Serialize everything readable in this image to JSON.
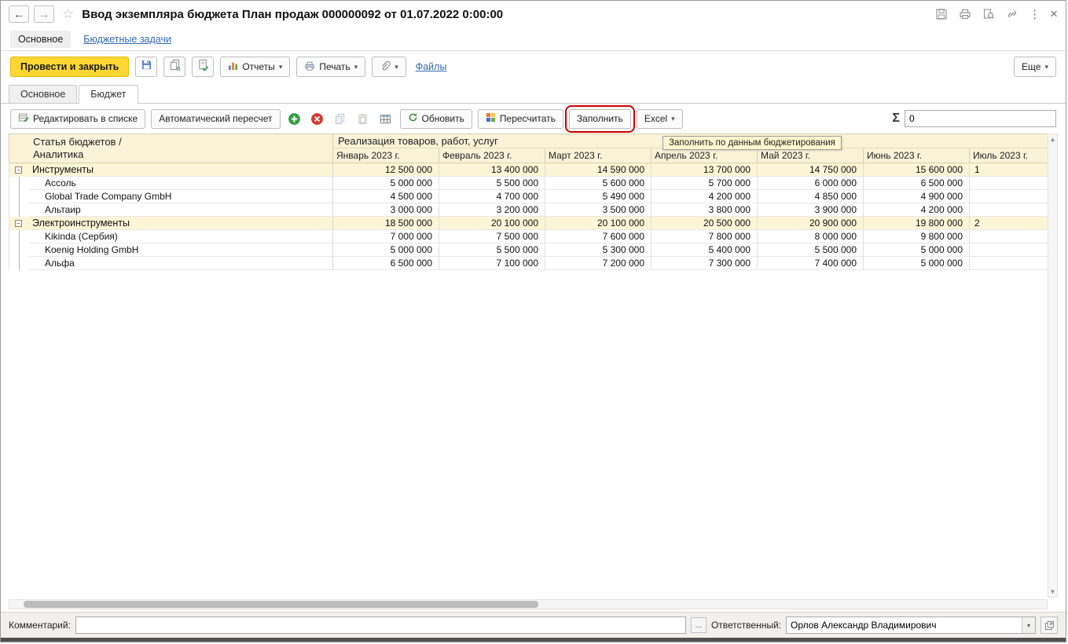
{
  "titlebar": {
    "title": "Ввод экземпляра бюджета План продаж 000000092 от 01.07.2022 0:00:00"
  },
  "icons": {
    "back": "←",
    "forward": "→",
    "star": "☆",
    "kebab": "⋮",
    "close": "×",
    "caret": "▾",
    "sigma": "Σ",
    "minus": "−",
    "up_arrow": "▲",
    "down_arrow": "▼",
    "ellipsis": "..."
  },
  "nav": {
    "section": "Основное",
    "link": "Бюджетные задачи"
  },
  "cmdbar": {
    "post_and_close": "Провести и закрыть",
    "reports": "Отчеты",
    "print": "Печать",
    "files": "Файлы",
    "more": "Еще"
  },
  "pagetabs": [
    {
      "label": "Основное"
    },
    {
      "label": "Бюджет"
    }
  ],
  "table_toolbar": {
    "edit_in_list": "Редактировать в списке",
    "auto_recalc": "Автоматический пересчет",
    "refresh": "Обновить",
    "recalc": "Пересчитать",
    "fill": "Заполнить",
    "excel": "Excel",
    "sum_value": "0"
  },
  "tooltip": {
    "text": "Заполнить по данным бюджетирования"
  },
  "table": {
    "header_col_line1": "Статья бюджетов /",
    "header_col_line2": "Аналитика",
    "header_group": "Реализация товаров, работ, услуг",
    "months": [
      "Январь 2023 г.",
      "Февраль 2023 г.",
      "Март 2023 г.",
      "Апрель 2023 г.",
      "Май 2023 г.",
      "Июнь 2023 г.",
      "Июль 2023 г."
    ],
    "rows": [
      {
        "name": "Инструменты",
        "group": true,
        "values": [
          "12 500 000",
          "13 400 000",
          "14 590 000",
          "13 700 000",
          "14 750 000",
          "15 600 000",
          "1"
        ]
      },
      {
        "name": "Ассоль",
        "group": false,
        "values": [
          "5 000 000",
          "5 500 000",
          "5 600 000",
          "5 700 000",
          "6 000 000",
          "6 500 000",
          ""
        ]
      },
      {
        "name": "Global Trade Company GmbH",
        "group": false,
        "values": [
          "4 500 000",
          "4 700 000",
          "5 490 000",
          "4 200 000",
          "4 850 000",
          "4 900 000",
          ""
        ]
      },
      {
        "name": "Альтаир",
        "group": false,
        "values": [
          "3 000 000",
          "3 200 000",
          "3 500 000",
          "3 800 000",
          "3 900 000",
          "4 200 000",
          ""
        ]
      },
      {
        "name": "Электроинструменты",
        "group": true,
        "values": [
          "18 500 000",
          "20 100 000",
          "20 100 000",
          "20 500 000",
          "20 900 000",
          "19 800 000",
          "2"
        ]
      },
      {
        "name": "Kikinda (Сербия)",
        "group": false,
        "values": [
          "7 000 000",
          "7 500 000",
          "7 600 000",
          "7 800 000",
          "8 000 000",
          "9 800 000",
          ""
        ]
      },
      {
        "name": "Koenig Holding GmbH",
        "group": false,
        "values": [
          "5 000 000",
          "5 500 000",
          "5 300 000",
          "5 400 000",
          "5 500 000",
          "5 000 000",
          ""
        ]
      },
      {
        "name": "Альфа",
        "group": false,
        "values": [
          "6 500 000",
          "7 100 000",
          "7 200 000",
          "7 300 000",
          "7 400 000",
          "5 000 000",
          ""
        ]
      }
    ]
  },
  "footer": {
    "comment_label": "Комментарий:",
    "comment_value": "",
    "responsible_label": "Ответственный:",
    "responsible_value": "Орлов Александр Владимирович"
  },
  "colors": {
    "accent_yellow": "#FFD632",
    "link_blue": "#3169B2",
    "header_cream": "#FAF3D8",
    "group_row": "#FCF5D6",
    "annotation_red": "#CC0000"
  }
}
